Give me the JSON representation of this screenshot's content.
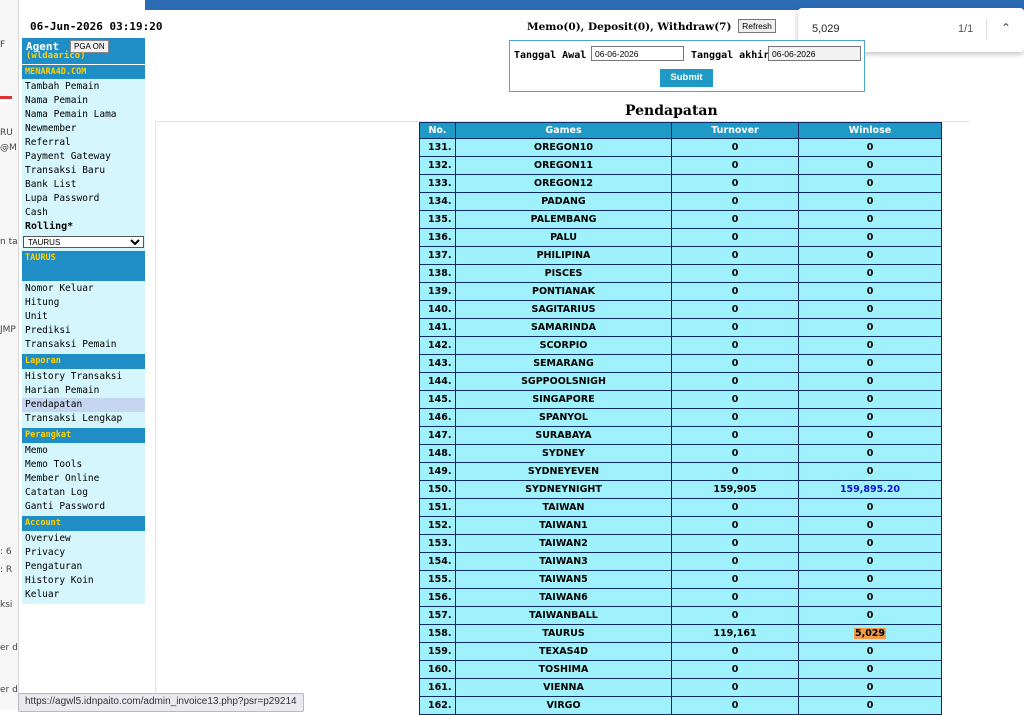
{
  "datetime": "06-Jun-2026 03:19:20",
  "left_fragments": [
    "F",
    "RU",
    "@M",
    "n ta",
    "JMP",
    ": 6",
    ": R",
    "ksi",
    "er da",
    "er da"
  ],
  "find_bar": {
    "query": "5,029",
    "count": "1/1"
  },
  "sidebar": {
    "agent_label": "Agent",
    "pga_button": "PGA ON",
    "agent_user": "(wldaarico)",
    "site_name": "MENARA4D.COM",
    "main_items": [
      "Tambah Pemain",
      "Nama Pemain",
      "Nama Pemain Lama",
      "Newmember",
      "Referral",
      "Payment Gateway",
      "Transaksi Baru",
      "Bank List",
      "Lupa Password",
      "Cash"
    ],
    "rolling_label": "Rolling*",
    "selected_market": "TAURUS",
    "market_title": "TAURUS",
    "market_items": [
      "Nomor Keluar",
      "Hitung",
      "Unit",
      "Prediksi",
      "Transaksi Pemain"
    ],
    "laporan_title": "Laporan",
    "laporan_items": [
      "History Transaksi",
      "Harian Pemain",
      "Pendapatan",
      "Transaksi Lengkap"
    ],
    "perangkat_title": "Perangkat",
    "perangkat_items": [
      "Memo",
      "Memo Tools",
      "Member Online",
      "Catatan Log",
      "Ganti Password"
    ],
    "account_title": "Account",
    "account_items": [
      "Overview",
      "Privacy",
      "Pengaturan",
      "History Koin",
      "Keluar"
    ]
  },
  "header": {
    "memo_line": "Memo(0), Deposit(0), Withdraw(7)",
    "refresh_label": "Refresh",
    "start_label": "Tanggal Awal",
    "start_value": "06-06-2026",
    "end_label": "Tanggal akhir",
    "end_value": "06-06-2026",
    "submit_label": "Submit"
  },
  "page_title": "Pendapatan",
  "table": {
    "columns": [
      "No.",
      "Games",
      "Turnover",
      "Winlose"
    ],
    "rows": [
      {
        "no": "131.",
        "game": "OREGON10",
        "turnover": "0",
        "winlose": "0"
      },
      {
        "no": "132.",
        "game": "OREGON11",
        "turnover": "0",
        "winlose": "0"
      },
      {
        "no": "133.",
        "game": "OREGON12",
        "turnover": "0",
        "winlose": "0"
      },
      {
        "no": "134.",
        "game": "PADANG",
        "turnover": "0",
        "winlose": "0"
      },
      {
        "no": "135.",
        "game": "PALEMBANG",
        "turnover": "0",
        "winlose": "0"
      },
      {
        "no": "136.",
        "game": "PALU",
        "turnover": "0",
        "winlose": "0"
      },
      {
        "no": "137.",
        "game": "PHILIPINA",
        "turnover": "0",
        "winlose": "0"
      },
      {
        "no": "138.",
        "game": "PISCES",
        "turnover": "0",
        "winlose": "0"
      },
      {
        "no": "139.",
        "game": "PONTIANAK",
        "turnover": "0",
        "winlose": "0"
      },
      {
        "no": "140.",
        "game": "SAGITARIUS",
        "turnover": "0",
        "winlose": "0"
      },
      {
        "no": "141.",
        "game": "SAMARINDA",
        "turnover": "0",
        "winlose": "0"
      },
      {
        "no": "142.",
        "game": "SCORPIO",
        "turnover": "0",
        "winlose": "0"
      },
      {
        "no": "143.",
        "game": "SEMARANG",
        "turnover": "0",
        "winlose": "0"
      },
      {
        "no": "144.",
        "game": "SGPPOOLSNIGH",
        "turnover": "0",
        "winlose": "0"
      },
      {
        "no": "145.",
        "game": "SINGAPORE",
        "turnover": "0",
        "winlose": "0"
      },
      {
        "no": "146.",
        "game": "SPANYOL",
        "turnover": "0",
        "winlose": "0"
      },
      {
        "no": "147.",
        "game": "SURABAYA",
        "turnover": "0",
        "winlose": "0"
      },
      {
        "no": "148.",
        "game": "SYDNEY",
        "turnover": "0",
        "winlose": "0"
      },
      {
        "no": "149.",
        "game": "SYDNEYEVEN",
        "turnover": "0",
        "winlose": "0"
      },
      {
        "no": "150.",
        "game": "SYDNEYNIGHT",
        "turnover": "159,905",
        "winlose": "159,895.20",
        "winlose_style": "blue"
      },
      {
        "no": "151.",
        "game": "TAIWAN",
        "turnover": "0",
        "winlose": "0"
      },
      {
        "no": "152.",
        "game": "TAIWAN1",
        "turnover": "0",
        "winlose": "0"
      },
      {
        "no": "153.",
        "game": "TAIWAN2",
        "turnover": "0",
        "winlose": "0"
      },
      {
        "no": "154.",
        "game": "TAIWAN3",
        "turnover": "0",
        "winlose": "0"
      },
      {
        "no": "155.",
        "game": "TAIWAN5",
        "turnover": "0",
        "winlose": "0"
      },
      {
        "no": "156.",
        "game": "TAIWAN6",
        "turnover": "0",
        "winlose": "0"
      },
      {
        "no": "157.",
        "game": "TAIWANBALL",
        "turnover": "0",
        "winlose": "0"
      },
      {
        "no": "158.",
        "game": "TAURUS",
        "turnover": "119,161",
        "winlose": "5,029",
        "winlose_style": "highlight"
      },
      {
        "no": "159.",
        "game": "TEXAS4D",
        "turnover": "0",
        "winlose": "0"
      },
      {
        "no": "160.",
        "game": "TOSHIMA",
        "turnover": "0",
        "winlose": "0"
      },
      {
        "no": "161.",
        "game": "VIENNA",
        "turnover": "0",
        "winlose": "0"
      },
      {
        "no": "162.",
        "game": "VIRGO",
        "turnover": "0",
        "winlose": "0"
      }
    ]
  },
  "status_url": "https://agwl5.idnpaito.com/admin_invoice13.php?psr=p29214",
  "colors": {
    "header_blue": "#1f9ac6",
    "row_cyan": "#9ff1fb",
    "menu_bg": "#d6f6fd",
    "section_title": "#ffd200",
    "winlose_blue": "#1010d8",
    "find_highlight": "#f39a44"
  }
}
